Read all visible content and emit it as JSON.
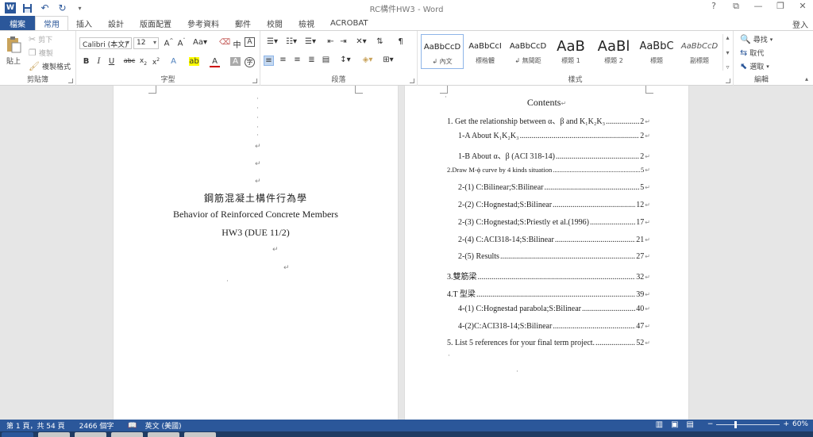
{
  "window": {
    "title": "RC構件HW3 - Word",
    "controls": [
      "?",
      "⧉",
      "—",
      "❐",
      "✕"
    ]
  },
  "qat": {
    "save_icon": "save-icon",
    "undo_icon": "undo-icon",
    "redo_icon": "redo-icon"
  },
  "tabs": [
    {
      "label": "檔案"
    },
    {
      "label": "常用"
    },
    {
      "label": "插入"
    },
    {
      "label": "設計"
    },
    {
      "label": "版面配置"
    },
    {
      "label": "參考資料"
    },
    {
      "label": "郵件"
    },
    {
      "label": "校閱"
    },
    {
      "label": "檢視"
    },
    {
      "label": "ACROBAT"
    }
  ],
  "login": "登入",
  "ribbon": {
    "clipboard": {
      "label": "剪貼簿",
      "paste": "貼上",
      "cut": "剪下",
      "copy": "複製",
      "format_painter": "複製格式"
    },
    "font": {
      "label": "字型",
      "font_name": "Calibri (本文)",
      "font_size": "12"
    },
    "paragraph": {
      "label": "段落"
    },
    "styles": {
      "label": "樣式",
      "items": [
        {
          "sample": "AaBbCcD",
          "name": "↲ 內文"
        },
        {
          "sample": "AaBbCcI",
          "name": "標楷體"
        },
        {
          "sample": "AaBbCcD",
          "name": "↲ 無間距"
        },
        {
          "sample": "AaB",
          "name": "標題 1"
        },
        {
          "sample": "AaBl",
          "name": "標題 2"
        },
        {
          "sample": "AaBbC",
          "name": "標題"
        },
        {
          "sample": "AaBbCcD",
          "name": "副標題"
        }
      ]
    },
    "editing": {
      "label": "編輯",
      "find": "尋找",
      "replace": "取代",
      "select": "選取"
    }
  },
  "page1": {
    "title_cn": "鋼筋混凝土構件行為學",
    "title_en": "Behavior of Reinforced Concrete Members",
    "hw": "HW3 (DUE 11/2)"
  },
  "toc": {
    "title": "Contents",
    "entries": [
      {
        "text": "1. Get the relationship between α、β and K₁K₂K₃",
        "page": "2",
        "level": 1
      },
      {
        "text": "1-A About K₁K₂K₃",
        "page": "2",
        "level": 2
      },
      {
        "text": "1-B About α、β (ACI 318-14)",
        "page": "2",
        "level": 2
      },
      {
        "text": "2.Draw M-ϕ curve by 4 kinds situation",
        "page": "5",
        "level": 1,
        "small": true
      },
      {
        "text": "2-(1) C:Bilinear;S:Bilinear",
        "page": "5",
        "level": 2
      },
      {
        "text": "2-(2) C:Hognestad;S:Bilinear",
        "page": "12",
        "level": 2
      },
      {
        "text": "2-(3) C:Hognestad;S:Priestly et al.(1996)",
        "page": "17",
        "level": 2
      },
      {
        "text": "2-(4) C:ACI318-14;S:Bilinear",
        "page": "21",
        "level": 2
      },
      {
        "text": "2-(5) Results",
        "page": "27",
        "level": 2
      },
      {
        "text": "3.雙筋梁",
        "page": "32",
        "level": 1
      },
      {
        "text": "4.T 型梁",
        "page": "39",
        "level": 1
      },
      {
        "text": "4-(1) C:Hognestad parabola;S:Bilinear",
        "page": "40",
        "level": 2
      },
      {
        "text": "4-(2)C:ACI318-14;S:Bilinear",
        "page": "47",
        "level": 2
      },
      {
        "text": "5. List 5 references for your final term project.",
        "page": "52",
        "level": 1
      }
    ]
  },
  "status": {
    "page": "第 1 頁，共 54 頁",
    "words": "2466 個字",
    "language": "英文 (美國)",
    "zoom": "60%",
    "zoom_level": 0.6
  }
}
